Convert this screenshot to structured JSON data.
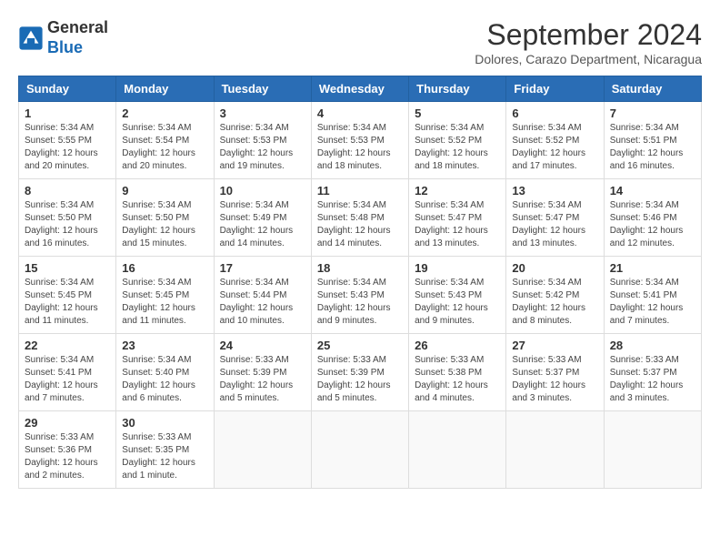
{
  "logo": {
    "line1": "General",
    "line2": "Blue"
  },
  "title": "September 2024",
  "location": "Dolores, Carazo Department, Nicaragua",
  "days_of_week": [
    "Sunday",
    "Monday",
    "Tuesday",
    "Wednesday",
    "Thursday",
    "Friday",
    "Saturday"
  ],
  "weeks": [
    [
      {
        "day": 1,
        "info": "Sunrise: 5:34 AM\nSunset: 5:55 PM\nDaylight: 12 hours\nand 20 minutes."
      },
      {
        "day": 2,
        "info": "Sunrise: 5:34 AM\nSunset: 5:54 PM\nDaylight: 12 hours\nand 20 minutes."
      },
      {
        "day": 3,
        "info": "Sunrise: 5:34 AM\nSunset: 5:53 PM\nDaylight: 12 hours\nand 19 minutes."
      },
      {
        "day": 4,
        "info": "Sunrise: 5:34 AM\nSunset: 5:53 PM\nDaylight: 12 hours\nand 18 minutes."
      },
      {
        "day": 5,
        "info": "Sunrise: 5:34 AM\nSunset: 5:52 PM\nDaylight: 12 hours\nand 18 minutes."
      },
      {
        "day": 6,
        "info": "Sunrise: 5:34 AM\nSunset: 5:52 PM\nDaylight: 12 hours\nand 17 minutes."
      },
      {
        "day": 7,
        "info": "Sunrise: 5:34 AM\nSunset: 5:51 PM\nDaylight: 12 hours\nand 16 minutes."
      }
    ],
    [
      {
        "day": 8,
        "info": "Sunrise: 5:34 AM\nSunset: 5:50 PM\nDaylight: 12 hours\nand 16 minutes."
      },
      {
        "day": 9,
        "info": "Sunrise: 5:34 AM\nSunset: 5:50 PM\nDaylight: 12 hours\nand 15 minutes."
      },
      {
        "day": 10,
        "info": "Sunrise: 5:34 AM\nSunset: 5:49 PM\nDaylight: 12 hours\nand 14 minutes."
      },
      {
        "day": 11,
        "info": "Sunrise: 5:34 AM\nSunset: 5:48 PM\nDaylight: 12 hours\nand 14 minutes."
      },
      {
        "day": 12,
        "info": "Sunrise: 5:34 AM\nSunset: 5:47 PM\nDaylight: 12 hours\nand 13 minutes."
      },
      {
        "day": 13,
        "info": "Sunrise: 5:34 AM\nSunset: 5:47 PM\nDaylight: 12 hours\nand 13 minutes."
      },
      {
        "day": 14,
        "info": "Sunrise: 5:34 AM\nSunset: 5:46 PM\nDaylight: 12 hours\nand 12 minutes."
      }
    ],
    [
      {
        "day": 15,
        "info": "Sunrise: 5:34 AM\nSunset: 5:45 PM\nDaylight: 12 hours\nand 11 minutes."
      },
      {
        "day": 16,
        "info": "Sunrise: 5:34 AM\nSunset: 5:45 PM\nDaylight: 12 hours\nand 11 minutes."
      },
      {
        "day": 17,
        "info": "Sunrise: 5:34 AM\nSunset: 5:44 PM\nDaylight: 12 hours\nand 10 minutes."
      },
      {
        "day": 18,
        "info": "Sunrise: 5:34 AM\nSunset: 5:43 PM\nDaylight: 12 hours\nand 9 minutes."
      },
      {
        "day": 19,
        "info": "Sunrise: 5:34 AM\nSunset: 5:43 PM\nDaylight: 12 hours\nand 9 minutes."
      },
      {
        "day": 20,
        "info": "Sunrise: 5:34 AM\nSunset: 5:42 PM\nDaylight: 12 hours\nand 8 minutes."
      },
      {
        "day": 21,
        "info": "Sunrise: 5:34 AM\nSunset: 5:41 PM\nDaylight: 12 hours\nand 7 minutes."
      }
    ],
    [
      {
        "day": 22,
        "info": "Sunrise: 5:34 AM\nSunset: 5:41 PM\nDaylight: 12 hours\nand 7 minutes."
      },
      {
        "day": 23,
        "info": "Sunrise: 5:34 AM\nSunset: 5:40 PM\nDaylight: 12 hours\nand 6 minutes."
      },
      {
        "day": 24,
        "info": "Sunrise: 5:33 AM\nSunset: 5:39 PM\nDaylight: 12 hours\nand 5 minutes."
      },
      {
        "day": 25,
        "info": "Sunrise: 5:33 AM\nSunset: 5:39 PM\nDaylight: 12 hours\nand 5 minutes."
      },
      {
        "day": 26,
        "info": "Sunrise: 5:33 AM\nSunset: 5:38 PM\nDaylight: 12 hours\nand 4 minutes."
      },
      {
        "day": 27,
        "info": "Sunrise: 5:33 AM\nSunset: 5:37 PM\nDaylight: 12 hours\nand 3 minutes."
      },
      {
        "day": 28,
        "info": "Sunrise: 5:33 AM\nSunset: 5:37 PM\nDaylight: 12 hours\nand 3 minutes."
      }
    ],
    [
      {
        "day": 29,
        "info": "Sunrise: 5:33 AM\nSunset: 5:36 PM\nDaylight: 12 hours\nand 2 minutes."
      },
      {
        "day": 30,
        "info": "Sunrise: 5:33 AM\nSunset: 5:35 PM\nDaylight: 12 hours\nand 1 minute."
      },
      null,
      null,
      null,
      null,
      null
    ]
  ]
}
